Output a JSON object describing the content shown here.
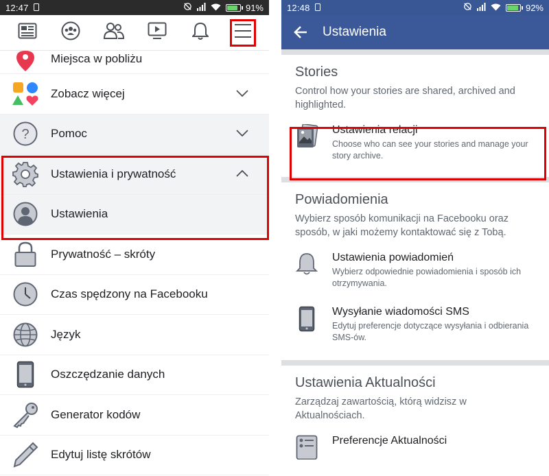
{
  "left": {
    "status": {
      "time": "12:47",
      "battery": "91%",
      "battery_level": 0.91
    },
    "menu": [
      {
        "label": "Miejsca w pobliżu",
        "icon": "map-pin-icon"
      },
      {
        "label": "Zobacz więcej",
        "icon": "shapes-icon",
        "chevron": "down"
      },
      {
        "label": "Pomoc",
        "icon": "help-icon",
        "chevron": "down"
      },
      {
        "label": "Ustawienia i prywatność",
        "icon": "gear-icon",
        "chevron": "up"
      },
      {
        "label": "Ustawienia",
        "icon": "user-icon"
      },
      {
        "label": "Prywatność – skróty",
        "icon": "lock-icon"
      },
      {
        "label": "Czas spędzony na Facebooku",
        "icon": "clock-icon"
      },
      {
        "label": "Język",
        "icon": "globe-icon"
      },
      {
        "label": "Oszczędzanie danych",
        "icon": "phone-icon"
      },
      {
        "label": "Generator kodów",
        "icon": "key-icon"
      },
      {
        "label": "Edytuj listę skrótów",
        "icon": "pencil-icon"
      }
    ]
  },
  "right": {
    "status": {
      "time": "12:48",
      "battery": "92%",
      "battery_level": 0.92
    },
    "header": {
      "title": "Ustawienia"
    },
    "stories": {
      "title": "Stories",
      "desc": "Control how your stories are shared, archived and highlighted.",
      "item": {
        "title": "Ustawienia relacji",
        "desc": "Choose who can see your stories and manage your story archive."
      }
    },
    "notifications": {
      "title": "Powiadomienia",
      "desc": "Wybierz sposób komunikacji na Facebooku oraz sposób, w jaki możemy kontaktować się z Tobą.",
      "items": [
        {
          "title": "Ustawienia powiadomień",
          "desc": "Wybierz odpowiednie powiadomienia i sposób ich otrzymywania."
        },
        {
          "title": "Wysyłanie wiadomości SMS",
          "desc": "Edytuj preferencje dotyczące wysyłania i odbierania SMS-ów."
        }
      ]
    },
    "newsfeed": {
      "title": "Ustawienia Aktualności",
      "desc": "Zarządzaj zawartością, którą widzisz w Aktualnościach.",
      "item": {
        "title": "Preferencje Aktualności"
      }
    }
  },
  "colors": {
    "fb_blue": "#3b5998",
    "highlight_red": "#e00000",
    "icon_gray": "#5f6673"
  }
}
